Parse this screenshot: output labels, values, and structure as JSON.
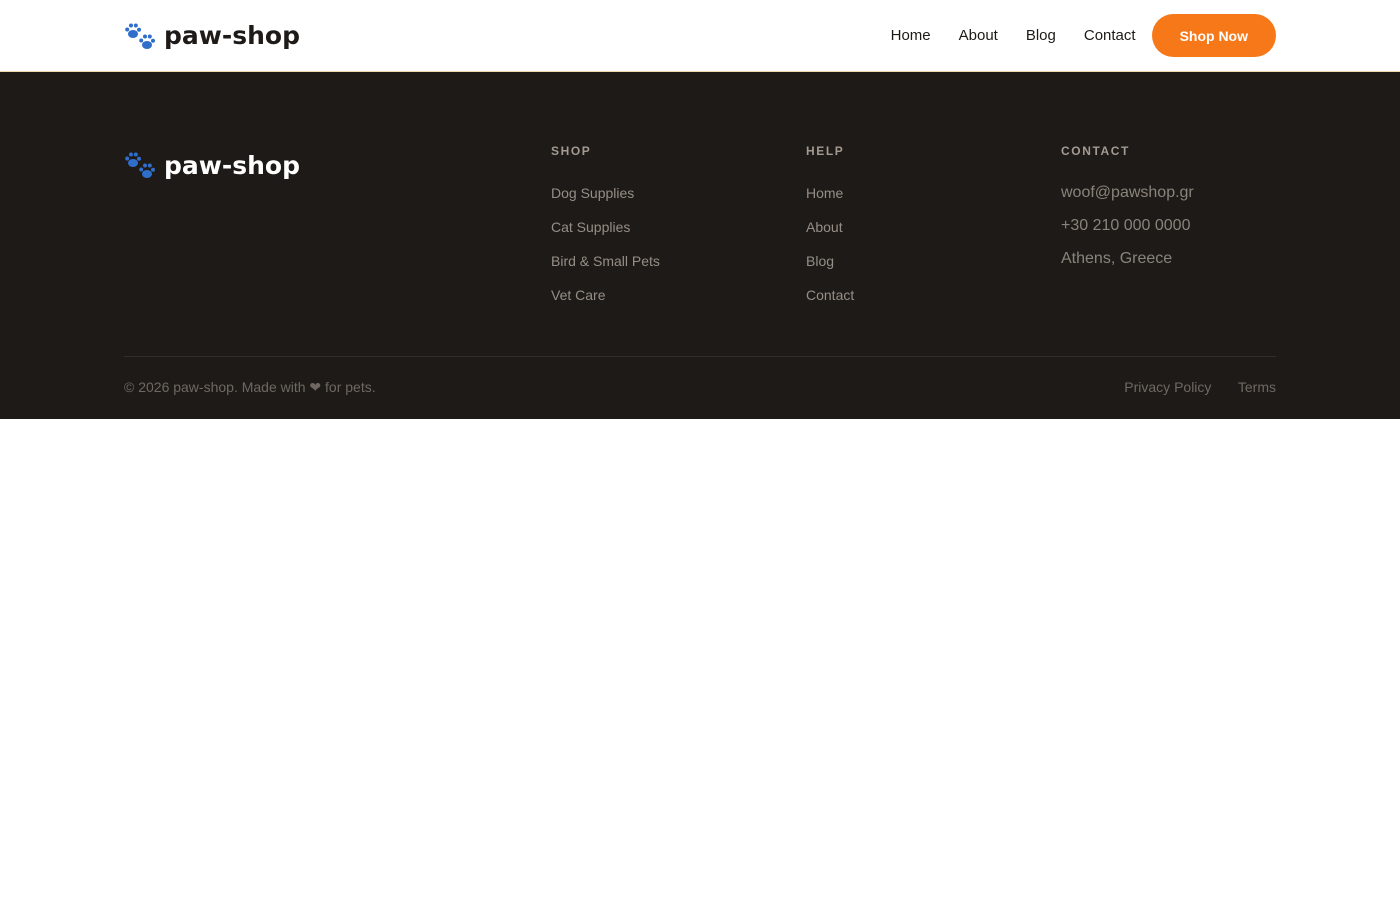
{
  "header": {
    "brand": "paw-shop",
    "brand_icon": "paw-prints-icon",
    "nav": [
      "Home",
      "About",
      "Blog",
      "Contact"
    ],
    "cta_label": "Shop Now"
  },
  "footer": {
    "brand": "paw-shop",
    "columns": {
      "shop": {
        "heading": "SHOP",
        "links": [
          "Dog Supplies",
          "Cat Supplies",
          "Bird & Small Pets",
          "Vet Care"
        ]
      },
      "help": {
        "heading": "HELP",
        "links": [
          "Home",
          "About",
          "Blog",
          "Contact"
        ]
      },
      "contact": {
        "heading": "CONTACT",
        "email": "woof@pawshop.gr",
        "phone": "+30 210 000 0000",
        "address": "Athens, Greece"
      }
    },
    "copyright": "© 2026 paw-shop. Made with ❤ for pets.",
    "legal": [
      "Privacy Policy",
      "Terms"
    ]
  },
  "colors": {
    "accent": "#f77818",
    "footer_bg": "#1e1a17",
    "paw_icon": "#2f6ecb"
  }
}
